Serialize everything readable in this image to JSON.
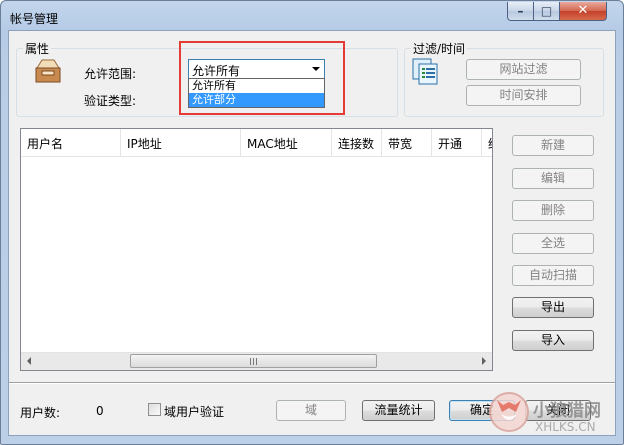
{
  "window": {
    "title": "帐号管理"
  },
  "properties": {
    "group_title": "属性",
    "scope_label": "允许范围:",
    "verify_label": "验证类型:",
    "scope_select": {
      "value": "允许所有",
      "options": [
        "允许所有",
        "允许部分"
      ],
      "highlighted_option": "允许部分"
    }
  },
  "filter": {
    "group_title": "过滤/时间",
    "web_filter_button": "网站过滤",
    "schedule_button": "时间安排"
  },
  "table": {
    "columns": [
      "用户名",
      "IP地址",
      "MAC地址",
      "连接数",
      "带宽",
      "开通",
      "终"
    ],
    "rows": [],
    "scroll_grip": "III"
  },
  "side_buttons": {
    "new": "新建",
    "edit": "编辑",
    "delete": "删除",
    "select_all": "全选",
    "auto_scan": "自动扫描",
    "export": "导出",
    "import": "导入"
  },
  "footer": {
    "user_count_label": "用户数:",
    "user_count": "0",
    "domain_verify_label": "域用户验证",
    "domain_verify_checked": false,
    "domain_button": "域",
    "traffic_button": "流量统计",
    "ok_button": "确定",
    "close_button": "关闭"
  },
  "watermark": {
    "brand": "小狼猎网",
    "url": "XHLKS.CN"
  },
  "colors": {
    "highlight": "#3399ff",
    "annotation_box": "#e33b35",
    "close_button": "#c4402a"
  }
}
